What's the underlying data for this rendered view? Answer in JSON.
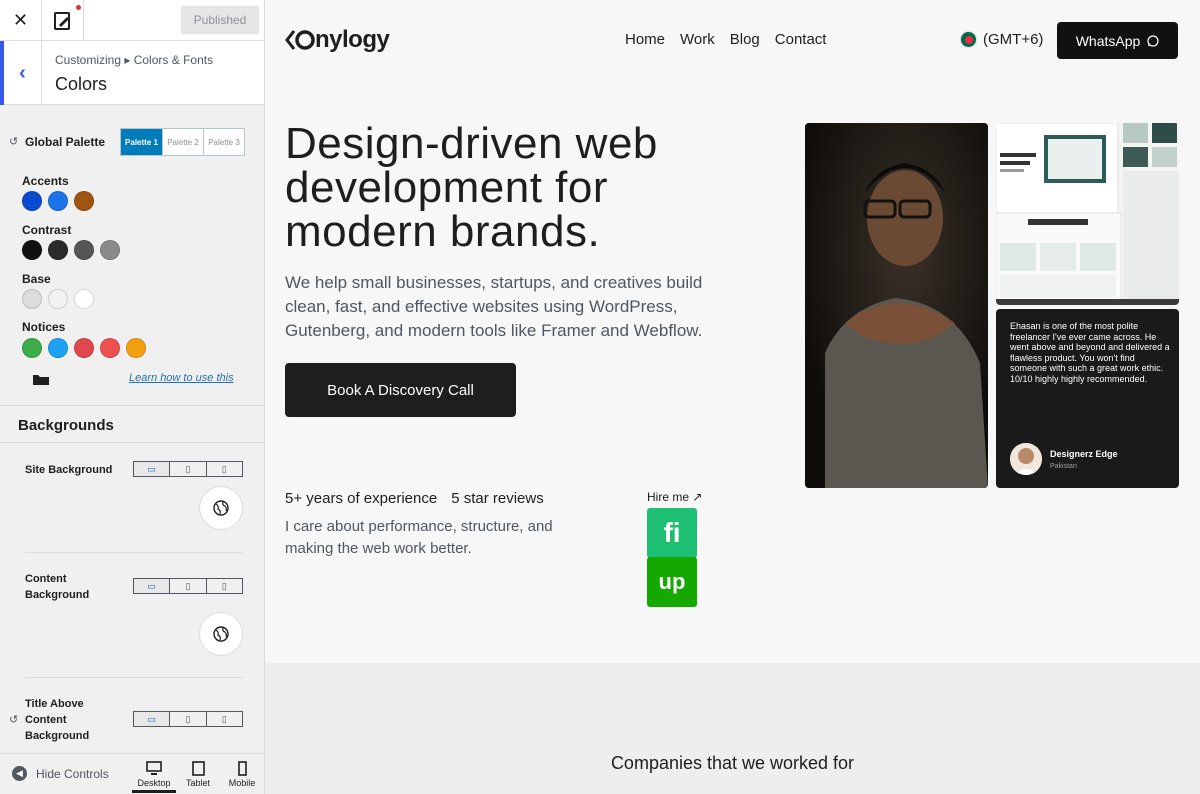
{
  "customizer": {
    "published_label": "Published",
    "breadcrumb": "Customizing ▸ Colors & Fonts",
    "section_title": "Colors",
    "global_palette": {
      "label": "Global Palette",
      "tabs": [
        "Palette 1",
        "Palette 2",
        "Palette 3"
      ],
      "active_tab": "Palette 1"
    },
    "swatch_groups": [
      {
        "label": "Accents",
        "colors": [
          "#0a4ad0",
          "#1a73e8",
          "#a05412"
        ]
      },
      {
        "label": "Contrast",
        "colors": [
          "#111111",
          "#2a2a2a",
          "#555555",
          "#8a8a8a"
        ]
      },
      {
        "label": "Base",
        "colors": [
          "#dddddd",
          "#f2f2f2",
          "#ffffff"
        ]
      },
      {
        "label": "Notices",
        "colors": [
          "#3cad4a",
          "#1da1f2",
          "#e0484d",
          "#ee5050",
          "#f5a00f"
        ]
      }
    ],
    "learn_link": "Learn how to use this",
    "backgrounds_heading": "Backgrounds",
    "background_controls": [
      {
        "label": "Site Background"
      },
      {
        "label": "Content Background"
      },
      {
        "label": "Title Above Content Background"
      }
    ],
    "footer": {
      "hide_controls": "Hide Controls",
      "devices": [
        "Desktop",
        "Tablet",
        "Mobile"
      ],
      "active_device": "Desktop"
    }
  },
  "site": {
    "logo_text": "nylogy",
    "nav": [
      "Home",
      "Work",
      "Blog",
      "Contact"
    ],
    "timezone": "(GMT+6)",
    "whatsapp_label": "WhatsApp",
    "hero_title": "Design-driven web development for modern brands.",
    "hero_subtitle": "We help small businesses, startups, and creatives build clean, fast, and effective websites using WordPress, Gutenberg, and modern tools like Framer and Webflow.",
    "cta_label": "Book A Discovery Call",
    "stats": [
      "5+ years of experience",
      "5 star reviews"
    ],
    "stats_subtitle": "I care about performance, structure, and making the web work better.",
    "hire_label": "Hire me ↗",
    "badges": [
      "fi",
      "up"
    ],
    "testimonial": {
      "text": "Ehasan is one of the most polite freelancer I've ever came across. He went above and beyond and delivered a flawless product. You won't find someone with such a great work ethic. 10/10 highly highly recommended.",
      "name": "Designerz Edge",
      "country": "Pakistan"
    },
    "companies_heading": "Companies that we worked for"
  }
}
